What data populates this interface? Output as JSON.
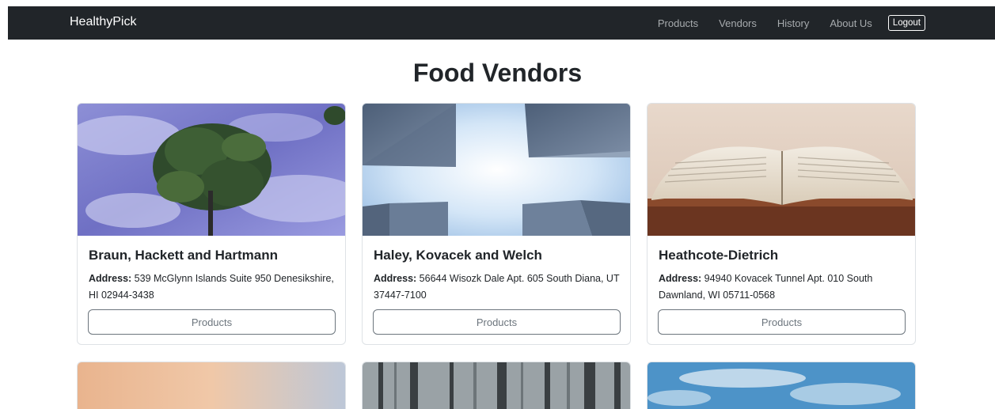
{
  "navbar": {
    "brand": "HealthyPick",
    "links": [
      "Products",
      "Vendors",
      "History",
      "About Us"
    ],
    "logout": "Logout"
  },
  "page": {
    "title": "Food Vendors"
  },
  "vendors": [
    {
      "name": "Braun, Hackett and Hartmann",
      "address_label": "Address:",
      "address": "539 McGlynn Islands Suite 950 Denesikshire, HI 02944-3438",
      "button": "Products",
      "image": "tree-reflection-photo"
    },
    {
      "name": "Haley, Kovacek and Welch",
      "address_label": "Address:",
      "address": "56644 Wisozk Dale Apt. 605 South Diana, UT 37447-7100",
      "button": "Products",
      "image": "skyscrapers-photo"
    },
    {
      "name": "Heathcote-Dietrich",
      "address_label": "Address:",
      "address": "94940 Kovacek Tunnel Apt. 010 South Dawnland, WI 05711-0568",
      "button": "Products",
      "image": "open-book-photo"
    }
  ],
  "next_row_images": [
    "sunset-sky-photo",
    "misty-forest-photo",
    "blue-sky-clouds-photo"
  ]
}
